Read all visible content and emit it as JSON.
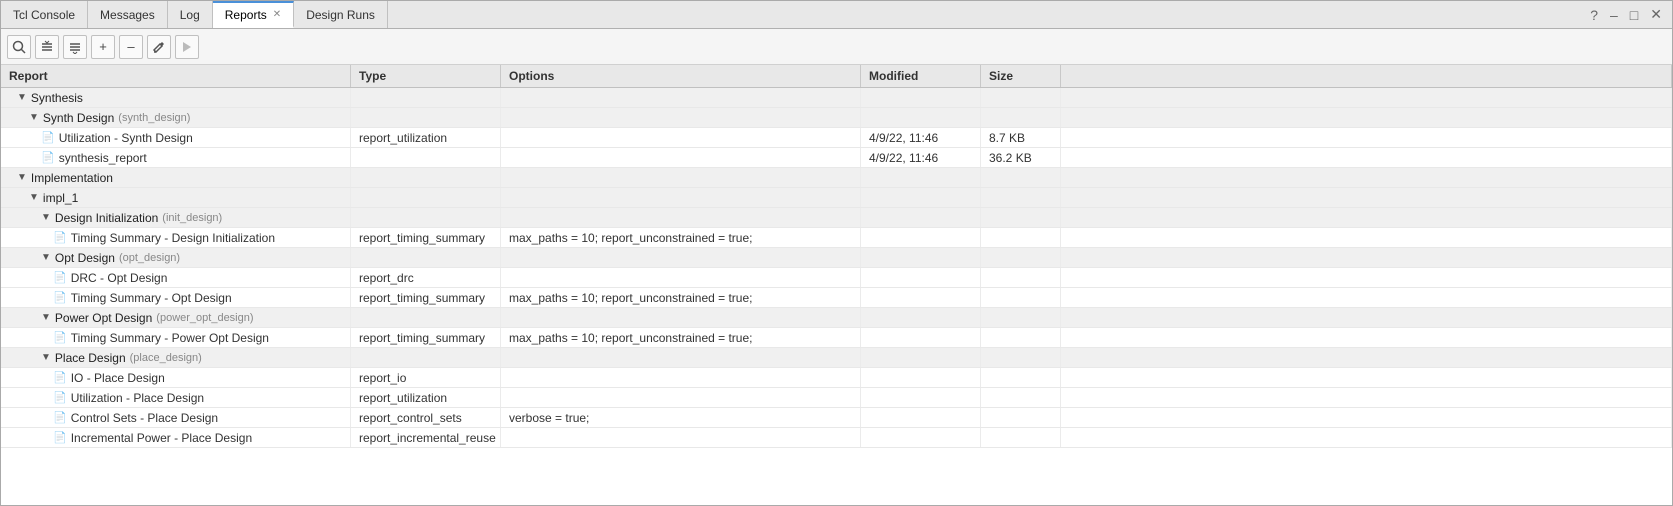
{
  "tabs": [
    {
      "label": "Tcl Console",
      "active": false,
      "closable": false
    },
    {
      "label": "Messages",
      "active": false,
      "closable": false
    },
    {
      "label": "Log",
      "active": false,
      "closable": false
    },
    {
      "label": "Reports",
      "active": true,
      "closable": true
    },
    {
      "label": "Design Runs",
      "active": false,
      "closable": false
    }
  ],
  "window_controls": {
    "help": "?",
    "minimize": "–",
    "restore": "□",
    "close": "✕"
  },
  "toolbar": {
    "search_label": "🔍",
    "collapse_all_label": "≡",
    "expand_all_label": "⇅",
    "add_label": "+",
    "remove_label": "–",
    "edit_label": "✎",
    "run_label": "▶"
  },
  "columns": [
    "Report",
    "Type",
    "Options",
    "Modified",
    "Size",
    ""
  ],
  "rows": [
    {
      "type": "group",
      "indent": 1,
      "expand": true,
      "label": "Synthesis",
      "sub": "",
      "col_type": "",
      "col_options": "",
      "col_modified": "",
      "col_size": ""
    },
    {
      "type": "group",
      "indent": 2,
      "expand": true,
      "label": "Synth Design",
      "sub": "(synth_design)",
      "col_type": "",
      "col_options": "",
      "col_modified": "",
      "col_size": ""
    },
    {
      "type": "file",
      "indent": 3,
      "icon": "blue",
      "label": "Utilization - Synth Design",
      "sub": "",
      "col_type": "report_utilization",
      "col_options": "",
      "col_modified": "4/9/22, 11:46",
      "col_size": "8.7 KB"
    },
    {
      "type": "file",
      "indent": 3,
      "icon": "green",
      "label": "synthesis_report",
      "sub": "",
      "col_type": "",
      "col_options": "",
      "col_modified": "4/9/22, 11:46",
      "col_size": "36.2 KB"
    },
    {
      "type": "group",
      "indent": 1,
      "expand": true,
      "label": "Implementation",
      "sub": "",
      "col_type": "",
      "col_options": "",
      "col_modified": "",
      "col_size": ""
    },
    {
      "type": "group",
      "indent": 2,
      "expand": true,
      "label": "impl_1",
      "sub": "",
      "col_type": "",
      "col_options": "",
      "col_modified": "",
      "col_size": ""
    },
    {
      "type": "group",
      "indent": 3,
      "expand": true,
      "label": "Design Initialization",
      "sub": "(init_design)",
      "col_type": "",
      "col_options": "",
      "col_modified": "",
      "col_size": ""
    },
    {
      "type": "file",
      "indent": 4,
      "icon": "gray",
      "label": "Timing Summary - Design Initialization",
      "sub": "",
      "col_type": "report_timing_summary",
      "col_options": "max_paths = 10; report_unconstrained = true;",
      "col_modified": "",
      "col_size": ""
    },
    {
      "type": "group",
      "indent": 3,
      "expand": true,
      "label": "Opt Design",
      "sub": "(opt_design)",
      "col_type": "",
      "col_options": "",
      "col_modified": "",
      "col_size": ""
    },
    {
      "type": "file",
      "indent": 4,
      "icon": "blue",
      "label": "DRC - Opt Design",
      "sub": "",
      "col_type": "report_drc",
      "col_options": "",
      "col_modified": "",
      "col_size": ""
    },
    {
      "type": "file",
      "indent": 4,
      "icon": "gray",
      "label": "Timing Summary - Opt Design",
      "sub": "",
      "col_type": "report_timing_summary",
      "col_options": "max_paths = 10; report_unconstrained = true;",
      "col_modified": "",
      "col_size": ""
    },
    {
      "type": "group",
      "indent": 3,
      "expand": true,
      "label": "Power Opt Design",
      "sub": "(power_opt_design)",
      "col_type": "",
      "col_options": "",
      "col_modified": "",
      "col_size": ""
    },
    {
      "type": "file",
      "indent": 4,
      "icon": "gray",
      "label": "Timing Summary - Power Opt Design",
      "sub": "",
      "col_type": "report_timing_summary",
      "col_options": "max_paths = 10; report_unconstrained = true;",
      "col_modified": "",
      "col_size": ""
    },
    {
      "type": "group",
      "indent": 3,
      "expand": true,
      "label": "Place Design",
      "sub": "(place_design)",
      "col_type": "",
      "col_options": "",
      "col_modified": "",
      "col_size": ""
    },
    {
      "type": "file",
      "indent": 4,
      "icon": "blue",
      "label": "IO - Place Design",
      "sub": "",
      "col_type": "report_io",
      "col_options": "",
      "col_modified": "",
      "col_size": ""
    },
    {
      "type": "file",
      "indent": 4,
      "icon": "blue",
      "label": "Utilization - Place Design",
      "sub": "",
      "col_type": "report_utilization",
      "col_options": "",
      "col_modified": "",
      "col_size": ""
    },
    {
      "type": "file",
      "indent": 4,
      "icon": "blue",
      "label": "Control Sets - Place Design",
      "sub": "",
      "col_type": "report_control_sets",
      "col_options": "verbose = true;",
      "col_modified": "",
      "col_size": ""
    },
    {
      "type": "file",
      "indent": 4,
      "icon": "gray",
      "label": "Incremental Power - Place Design",
      "sub": "",
      "col_type": "report_incremental_reuse",
      "col_options": "",
      "col_modified": "",
      "col_size": ""
    }
  ]
}
